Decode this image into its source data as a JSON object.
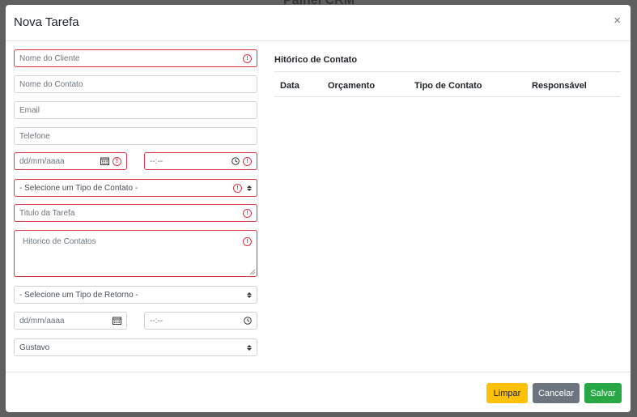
{
  "background": {
    "title": "Painel CRM"
  },
  "modal": {
    "title": "Nova Tarefa",
    "close_label": "×"
  },
  "form": {
    "cliente_placeholder": "Nome do Cliente",
    "contato_placeholder": "Nome do Contato",
    "email_placeholder": "Email",
    "telefone_placeholder": "Telefone",
    "data_placeholder": "dd/mm/aaaa",
    "hora_placeholder": "--:--",
    "tipo_contato_selected": "- Selecione um Tipo de Contato -",
    "titulo_placeholder": "Titulo da Tarefa",
    "historico_placeholder": "Hitorico de Contatos",
    "tipo_retorno_selected": "- Selecione um Tipo de Retorno -",
    "retorno_data_placeholder": "dd/mm/aaaa",
    "retorno_hora_placeholder": "--:--",
    "responsavel_selected": "Gustavo",
    "error_mark": "!"
  },
  "history": {
    "title": "Hitórico de Contato",
    "columns": [
      "Data",
      "Orçamento",
      "Tipo de Contato",
      "Responsável"
    ]
  },
  "footer": {
    "limpar_label": "Limpar",
    "cancelar_label": "Cancelar",
    "salvar_label": "Salvar"
  },
  "colors": {
    "invalid_border": "#dc3545",
    "warning": "#ffc107",
    "secondary": "#6c757d",
    "success": "#28a745"
  }
}
